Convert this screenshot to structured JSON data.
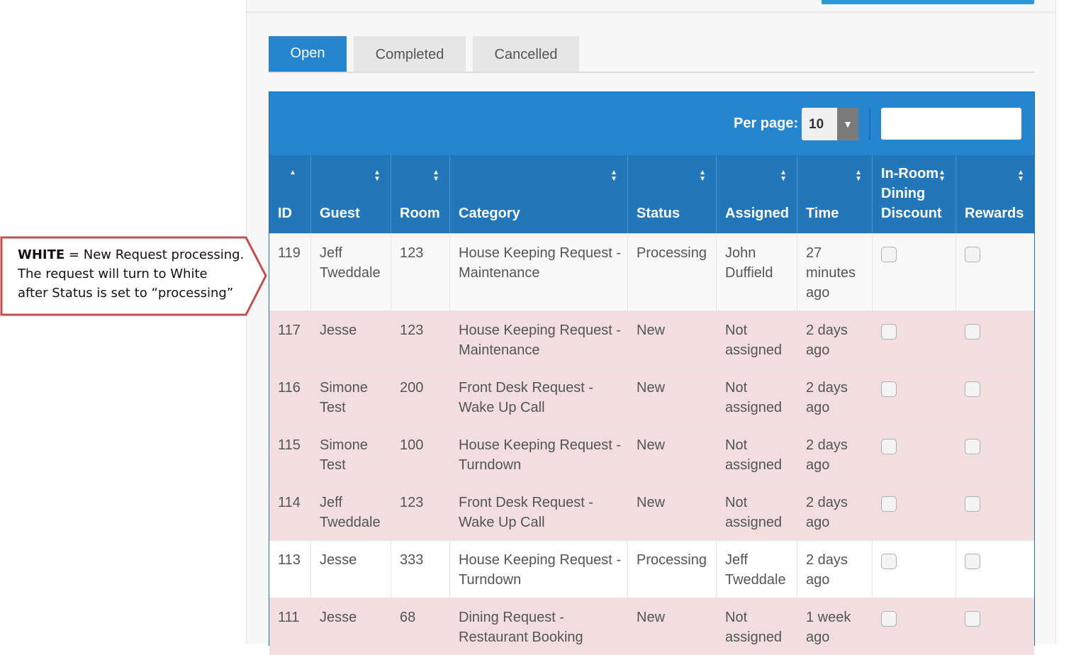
{
  "tabs": [
    {
      "label": "Open",
      "active": true
    },
    {
      "label": "Completed",
      "active": false
    },
    {
      "label": "Cancelled",
      "active": false
    }
  ],
  "toolbar": {
    "per_page_label": "Per page:",
    "per_page_value": "10",
    "search_value": ""
  },
  "columns": [
    {
      "label": "ID",
      "sort": "asc"
    },
    {
      "label": "Guest",
      "sort": "both"
    },
    {
      "label": "Room",
      "sort": "both"
    },
    {
      "label": "Category",
      "sort": "both"
    },
    {
      "label": "Status",
      "sort": "both"
    },
    {
      "label": "Assigned",
      "sort": "both"
    },
    {
      "label": "Time",
      "sort": "both"
    },
    {
      "label": "In-Room Dining Discount",
      "sort": "both"
    },
    {
      "label": "Rewards",
      "sort": "both"
    }
  ],
  "rows": [
    {
      "id": "119",
      "guest": "Jeff Tweddale",
      "room": "123",
      "category": "House Keeping Request - Maintenance",
      "status": "Processing",
      "assigned": "John Duffield",
      "time": "27 minutes ago",
      "color": "white"
    },
    {
      "id": "117",
      "guest": "Jesse",
      "room": "123",
      "category": "House Keeping Request - Maintenance",
      "status": "New",
      "assigned": "Not assigned",
      "time": "2 days ago",
      "color": "pink"
    },
    {
      "id": "116",
      "guest": "Simone Test",
      "room": "200",
      "category": "Front Desk Request - Wake Up Call",
      "status": "New",
      "assigned": "Not assigned",
      "time": "2 days ago",
      "color": "pink"
    },
    {
      "id": "115",
      "guest": "Simone Test",
      "room": "100",
      "category": "House Keeping Request - Turndown",
      "status": "New",
      "assigned": "Not assigned",
      "time": "2 days ago",
      "color": "pink"
    },
    {
      "id": "114",
      "guest": "Jeff Tweddale",
      "room": "123",
      "category": "Front Desk Request - Wake Up Call",
      "status": "New",
      "assigned": "Not assigned",
      "time": "2 days ago",
      "color": "pink"
    },
    {
      "id": "113",
      "guest": "Jesse",
      "room": "333",
      "category": "House Keeping Request - Turndown",
      "status": "Processing",
      "assigned": "Jeff Tweddale",
      "time": "2 days ago",
      "color": "white2"
    },
    {
      "id": "111",
      "guest": "Jesse",
      "room": "68",
      "category": "Dining Request - Restaurant Booking",
      "status": "New",
      "assigned": "Not assigned",
      "time": "1 week ago",
      "color": "pink"
    }
  ],
  "callout": {
    "bold": "WHITE",
    "rest_line1": " = New Request processing.",
    "line2": "The request will turn to White",
    "line3": "after  Status is set to “processing”"
  },
  "colors": {
    "primary": "#2585cf",
    "header": "#2277bb",
    "pink_row": "#f2dede",
    "callout_border": "#c0504d"
  }
}
